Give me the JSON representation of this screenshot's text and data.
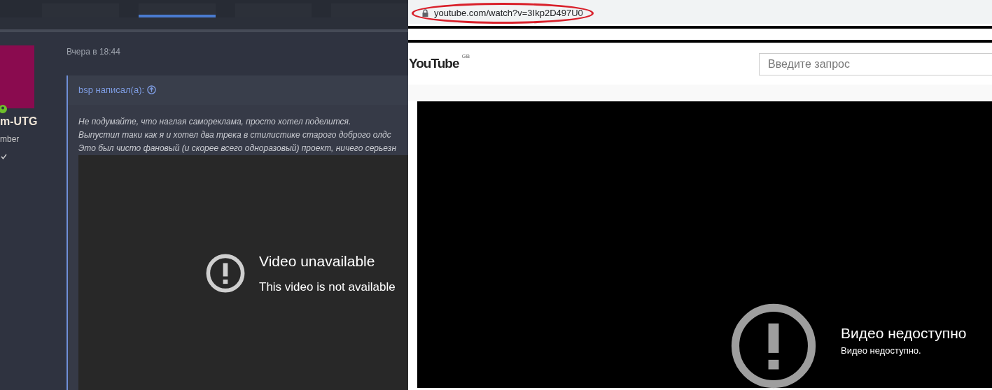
{
  "left_panel": {
    "nav_tabs": [
      {
        "selected": false
      },
      {
        "selected": true
      },
      {
        "selected": false
      },
      {
        "selected": false
      }
    ],
    "user": {
      "online": true,
      "name": "m-UTG",
      "role": "mber",
      "verified": true
    },
    "post": {
      "timestamp": "Вчера в 18:44",
      "quote": {
        "author": "bsp написал(а):",
        "lines": [
          "Не подумайте, что наглая самореклама, просто хотел поделится.",
          "Выпустил таки как я и хотел два трека в стилистике старого доброго олдс",
          "Это был чисто фановый (и скорее всего одноразовый) проект, ничего серьезн"
        ]
      },
      "embed": {
        "title": "Video unavailable",
        "message": "This video is not available"
      }
    }
  },
  "right_panel": {
    "address_bar": {
      "url": "youtube.com/watch?v=3Ikp2D497U0",
      "highlighted": true
    },
    "header": {
      "logo": "YouTube",
      "region": "GB",
      "search": {
        "placeholder": "Введите запрос"
      }
    },
    "player": {
      "title": "Видео недоступно",
      "message": "Видео недоступно."
    }
  }
}
